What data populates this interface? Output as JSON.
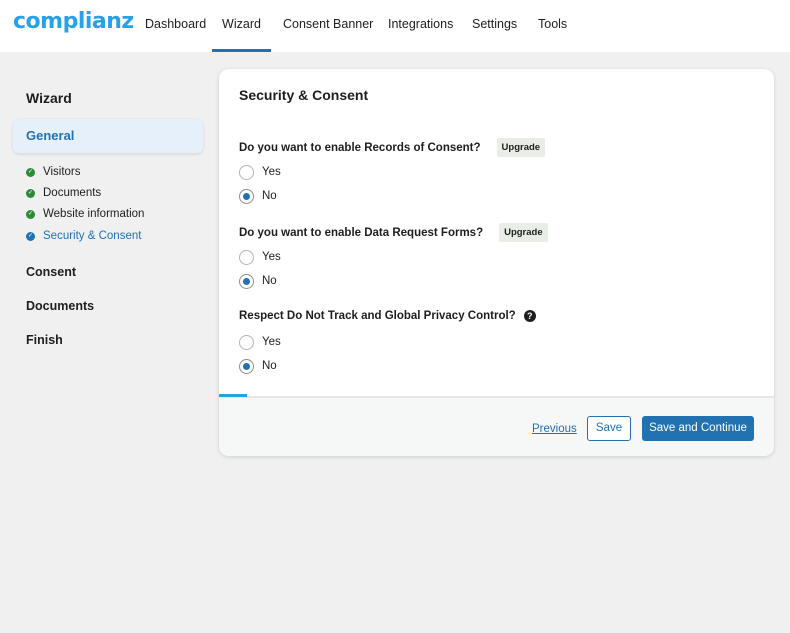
{
  "brand": {
    "logo_text": "complianz",
    "accent": "#29a1e6",
    "primary": "#2271b1"
  },
  "nav": {
    "items": [
      {
        "label": "Dashboard",
        "active": false
      },
      {
        "label": "Wizard",
        "active": true
      },
      {
        "label": "Consent Banner",
        "active": false
      },
      {
        "label": "Integrations",
        "active": false
      },
      {
        "label": "Settings",
        "active": false
      },
      {
        "label": "Tools",
        "active": false
      }
    ]
  },
  "sidebar": {
    "title": "Wizard",
    "active_section": "General",
    "steps": [
      {
        "label": "Visitors",
        "status": "done"
      },
      {
        "label": "Documents",
        "status": "done"
      },
      {
        "label": "Website information",
        "status": "done"
      },
      {
        "label": "Security & Consent",
        "status": "current"
      }
    ],
    "sections": [
      "Consent",
      "Documents",
      "Finish"
    ]
  },
  "card": {
    "title": "Security & Consent",
    "questions": [
      {
        "label": "Do you want to enable Records of Consent?",
        "badge": "Upgrade",
        "options": [
          "Yes",
          "No"
        ],
        "selected": "No"
      },
      {
        "label": "Do you want to enable Data Request Forms?",
        "badge": "Upgrade",
        "options": [
          "Yes",
          "No"
        ],
        "selected": "No"
      },
      {
        "label": "Respect Do Not Track and Global Privacy Control?",
        "help_icon": "question-circle-icon",
        "options": [
          "Yes",
          "No"
        ],
        "selected": "No"
      }
    ],
    "progress": 0.05,
    "footer": {
      "previous_label": "Previous",
      "save_label": "Save",
      "continue_label": "Save and Continue"
    }
  }
}
